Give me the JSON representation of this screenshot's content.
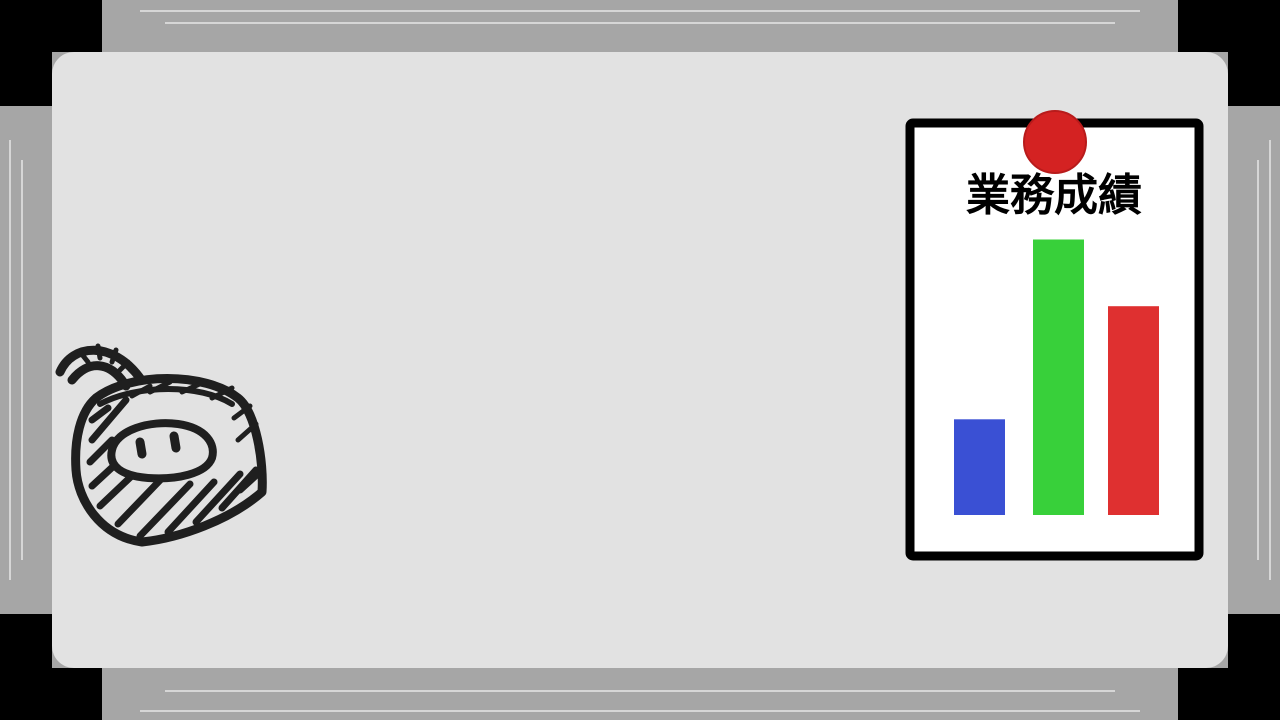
{
  "colors": {
    "frame": "#a6a6a6",
    "frame_highlight": "#d6d6d6",
    "corner_cap": "#000000",
    "board_surface": "#e2e2e2",
    "paper": "#ffffff",
    "paper_border": "#000000",
    "magnet": "#d42222",
    "marker": "#1f1f1f"
  },
  "paper": {
    "title": "業務成績"
  },
  "chart_data": {
    "type": "bar",
    "title": "業務成績",
    "categories": [],
    "values": [
      33,
      95,
      72
    ],
    "bar_colors": [
      "#3a50d4",
      "#38d03a",
      "#df3030"
    ],
    "ylim": [
      0,
      100
    ],
    "xlabel": "",
    "ylabel": "",
    "grid": false
  },
  "icons": {
    "magnet": "red-round-magnet-icon",
    "doodle": "marker-doodle-pot-icon"
  }
}
